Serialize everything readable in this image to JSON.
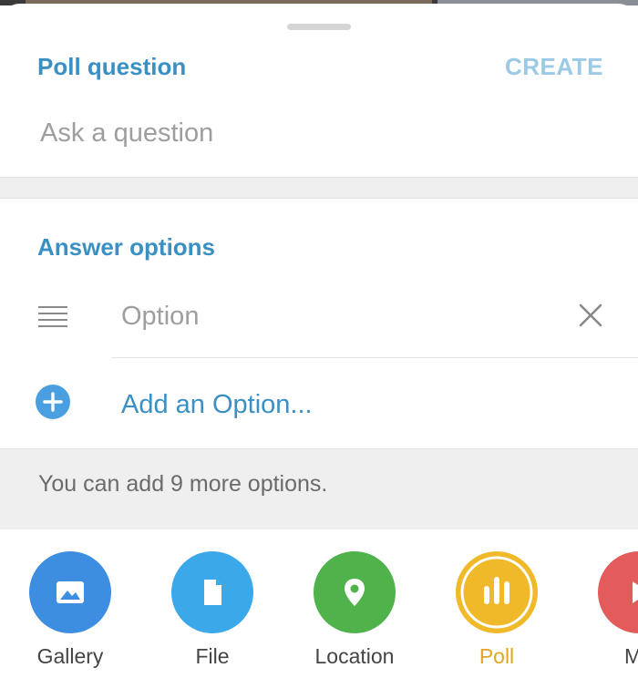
{
  "poll": {
    "question_title": "Poll question",
    "create_label": "CREATE",
    "question_placeholder": "Ask a question",
    "answers_title": "Answer options",
    "option_placeholder": "Option",
    "add_option_label": "Add an Option...",
    "info_text": "You can add 9 more options."
  },
  "attachments": [
    {
      "label": "Gallery",
      "icon": "gallery-icon",
      "color": "#3d8ee0"
    },
    {
      "label": "File",
      "icon": "file-icon",
      "color": "#3ba8ea"
    },
    {
      "label": "Location",
      "icon": "location-icon",
      "color": "#4fb24a"
    },
    {
      "label": "Poll",
      "icon": "poll-icon",
      "color": "#f0b929",
      "selected": true
    },
    {
      "label": "Mu",
      "icon": "music-icon",
      "color": "#e35b5b"
    }
  ],
  "colors": {
    "accent": "#3a8fc3",
    "create_disabled": "#9cc9e6",
    "selected_label": "#e0a81a"
  }
}
